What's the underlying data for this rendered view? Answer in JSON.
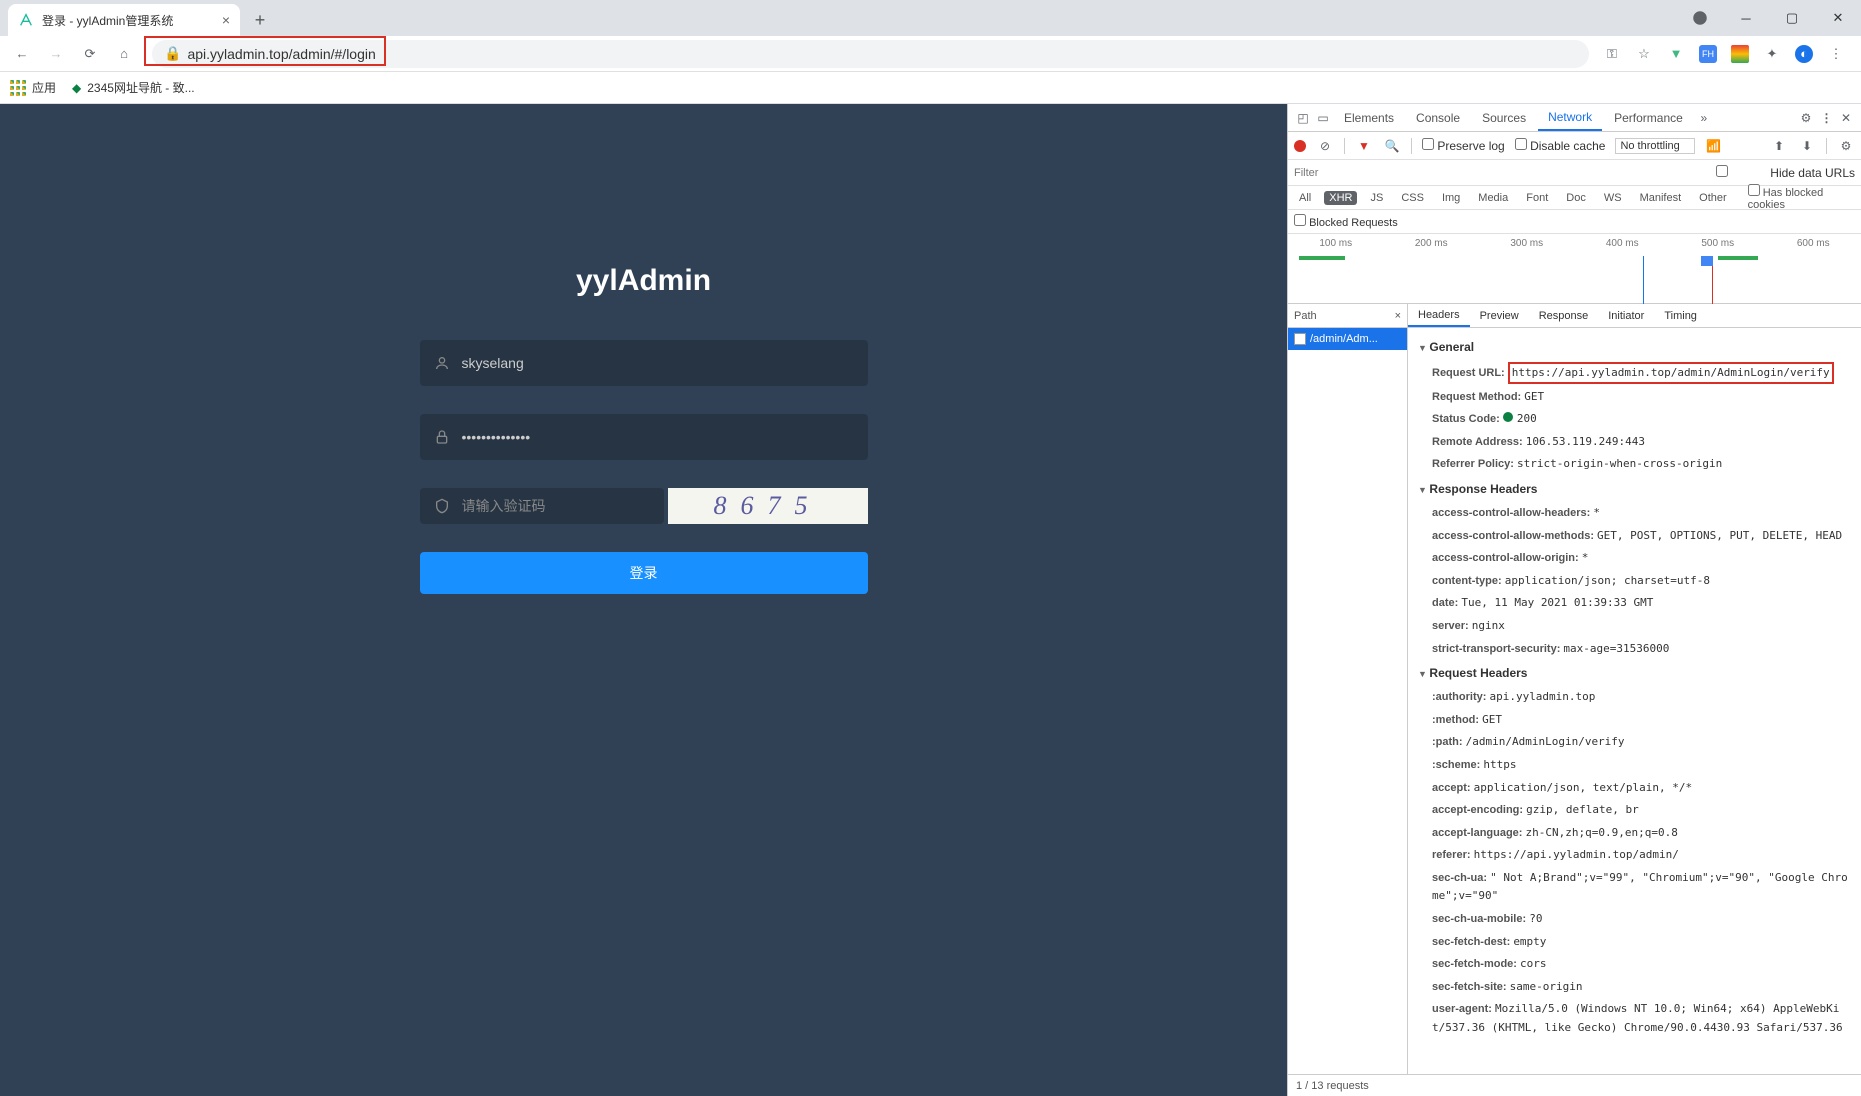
{
  "browser": {
    "tab_title": "登录 - yylAdmin管理系统",
    "url_display": "api.yyladmin.top/admin/#/login",
    "bookmarks": {
      "apps": "应用",
      "nav2345": "2345网址导航 - 致..."
    }
  },
  "page": {
    "logo": "yylAdmin",
    "username_value": "skyselang",
    "password_value": "••••••••••••••",
    "captcha_placeholder": "请输入验证码",
    "captcha_text": "8675",
    "login_btn": "登录"
  },
  "devtools": {
    "tabs": {
      "elements": "Elements",
      "console": "Console",
      "sources": "Sources",
      "network": "Network",
      "performance": "Performance"
    },
    "toolbar": {
      "preserve": "Preserve log",
      "disable_cache": "Disable cache",
      "throttling": "No throttling"
    },
    "filter": {
      "placeholder": "Filter",
      "hide_urls": "Hide data URLs"
    },
    "types": [
      "All",
      "XHR",
      "JS",
      "CSS",
      "Img",
      "Media",
      "Font",
      "Doc",
      "WS",
      "Manifest",
      "Other"
    ],
    "types_extra": "Has blocked cookies",
    "blocked": "Blocked Requests",
    "waterfall_labels": [
      "100 ms",
      "200 ms",
      "300 ms",
      "400 ms",
      "500 ms",
      "600 ms"
    ],
    "list": {
      "path_header": "Path",
      "item": "/admin/Adm..."
    },
    "detail_tabs": [
      "Headers",
      "Preview",
      "Response",
      "Initiator",
      "Timing"
    ],
    "general": {
      "title": "General",
      "request_url_label": "Request URL:",
      "request_url": "https://api.yyladmin.top/admin/AdminLogin/verify",
      "request_method_label": "Request Method:",
      "request_method": "GET",
      "status_code_label": "Status Code:",
      "status_code": "200",
      "remote_addr_label": "Remote Address:",
      "remote_addr": "106.53.119.249:443",
      "referrer_label": "Referrer Policy:",
      "referrer": "strict-origin-when-cross-origin"
    },
    "response_headers": {
      "title": "Response Headers",
      "items": [
        {
          "k": "access-control-allow-headers:",
          "v": "*"
        },
        {
          "k": "access-control-allow-methods:",
          "v": "GET, POST, OPTIONS, PUT, DELETE, HEAD"
        },
        {
          "k": "access-control-allow-origin:",
          "v": "*"
        },
        {
          "k": "content-type:",
          "v": "application/json; charset=utf-8"
        },
        {
          "k": "date:",
          "v": "Tue, 11 May 2021 01:39:33 GMT"
        },
        {
          "k": "server:",
          "v": "nginx"
        },
        {
          "k": "strict-transport-security:",
          "v": "max-age=31536000"
        }
      ]
    },
    "request_headers": {
      "title": "Request Headers",
      "items": [
        {
          "k": ":authority:",
          "v": "api.yyladmin.top"
        },
        {
          "k": ":method:",
          "v": "GET"
        },
        {
          "k": ":path:",
          "v": "/admin/AdminLogin/verify"
        },
        {
          "k": ":scheme:",
          "v": "https"
        },
        {
          "k": "accept:",
          "v": "application/json, text/plain, */*"
        },
        {
          "k": "accept-encoding:",
          "v": "gzip, deflate, br"
        },
        {
          "k": "accept-language:",
          "v": "zh-CN,zh;q=0.9,en;q=0.8"
        },
        {
          "k": "referer:",
          "v": "https://api.yyladmin.top/admin/"
        },
        {
          "k": "sec-ch-ua:",
          "v": "\" Not A;Brand\";v=\"99\", \"Chromium\";v=\"90\", \"Google Chrome\";v=\"90\""
        },
        {
          "k": "sec-ch-ua-mobile:",
          "v": "?0"
        },
        {
          "k": "sec-fetch-dest:",
          "v": "empty"
        },
        {
          "k": "sec-fetch-mode:",
          "v": "cors"
        },
        {
          "k": "sec-fetch-site:",
          "v": "same-origin"
        },
        {
          "k": "user-agent:",
          "v": "Mozilla/5.0 (Windows NT 10.0; Win64; x64) AppleWebKit/537.36 (KHTML, like Gecko) Chrome/90.0.4430.93 Safari/537.36"
        }
      ]
    },
    "status_bar": "1 / 13 requests"
  }
}
